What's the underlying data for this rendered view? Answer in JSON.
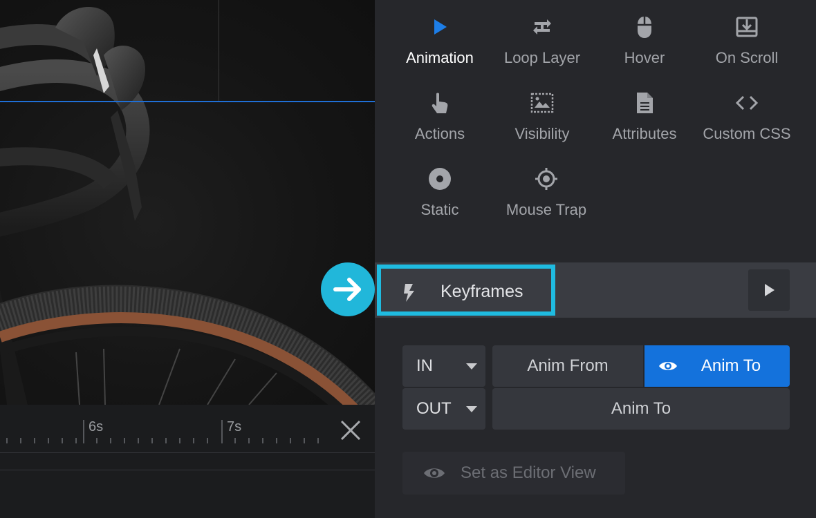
{
  "tabs": [
    {
      "id": "animation",
      "label": "Animation",
      "icon": "play-icon",
      "active": true
    },
    {
      "id": "loop-layer",
      "label": "Loop Layer",
      "icon": "loop-icon"
    },
    {
      "id": "hover",
      "label": "Hover",
      "icon": "mouse-icon"
    },
    {
      "id": "on-scroll",
      "label": "On Scroll",
      "icon": "scroll-download-icon"
    },
    {
      "id": "actions",
      "label": "Actions",
      "icon": "pointer-hand-icon"
    },
    {
      "id": "visibility",
      "label": "Visibility",
      "icon": "image-frame-icon"
    },
    {
      "id": "attributes",
      "label": "Attributes",
      "icon": "document-icon"
    },
    {
      "id": "custom-css",
      "label": "Custom CSS",
      "icon": "code-icon"
    },
    {
      "id": "static",
      "label": "Static",
      "icon": "record-icon"
    },
    {
      "id": "mouse-trap",
      "label": "Mouse Trap",
      "icon": "crosshair-icon"
    }
  ],
  "keyframes": {
    "label": "Keyframes",
    "icon": "bolt-icon"
  },
  "in_out": {
    "in_label": "IN",
    "out_label": "OUT",
    "anim_from_label": "Anim From",
    "anim_to_label": "Anim To",
    "out_anim_to_label": "Anim To"
  },
  "editor_view": {
    "label": "Set as Editor View"
  },
  "timeline": {
    "ticks": [
      "6s",
      "7s"
    ]
  },
  "colors": {
    "accent_blue": "#1472dc",
    "highlight_cyan": "#1fbbe0",
    "panel_bg": "#26272b"
  }
}
